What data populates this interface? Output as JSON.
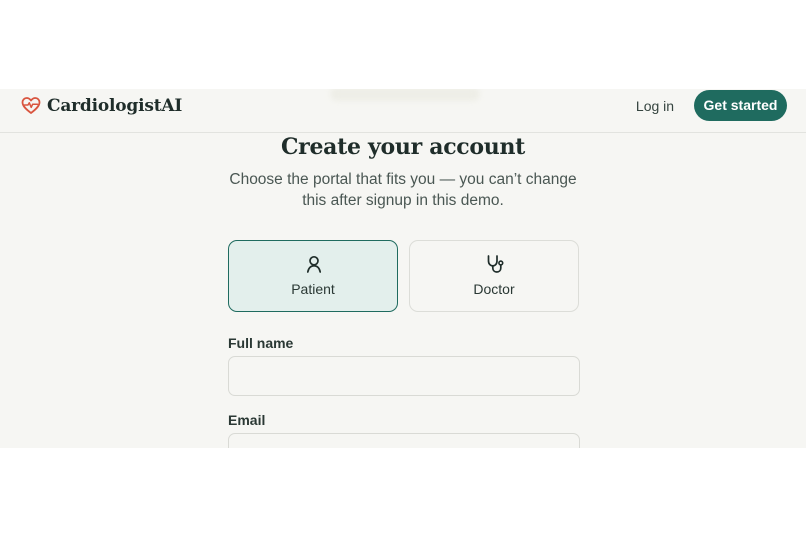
{
  "brand": {
    "name": "CardiologistAI",
    "accent": "#1f6b5f",
    "logo_color": "#d9553f"
  },
  "header": {
    "login_label": "Log in",
    "cta_label": "Get started"
  },
  "main": {
    "title": "Create your account",
    "subtitle": "Choose the portal that fits you — you can’t change this after signup in this demo."
  },
  "roles": [
    {
      "label": "Patient",
      "icon": "user-icon",
      "selected": true
    },
    {
      "label": "Doctor",
      "icon": "stethoscope-icon",
      "selected": false
    }
  ],
  "form": {
    "full_name": {
      "label": "Full name",
      "value": "",
      "placeholder": ""
    },
    "email": {
      "label": "Email",
      "value": "",
      "placeholder": ""
    }
  }
}
